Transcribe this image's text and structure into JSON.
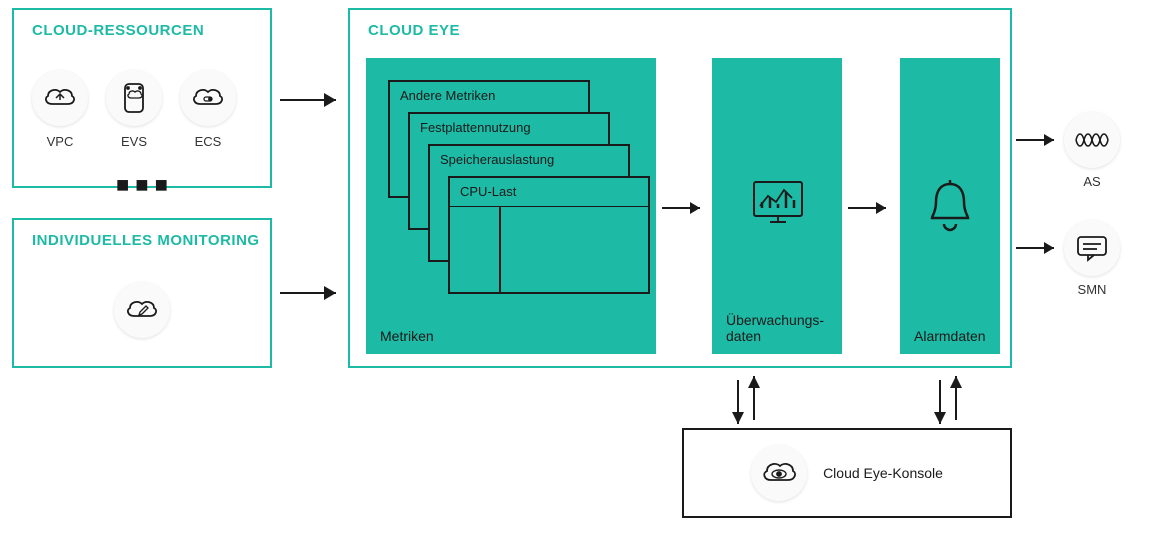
{
  "cloud_resources": {
    "title": "CLOUD-RESSOURCEN",
    "items": [
      {
        "label": "VPC"
      },
      {
        "label": "EVS"
      },
      {
        "label": "ECS"
      }
    ],
    "ellipsis": "■ ■ ■"
  },
  "individual_monitoring": {
    "title": "INDIVIDUELLES MONITORING"
  },
  "cloud_eye": {
    "title": "CLOUD EYE",
    "metrics_panel": {
      "label": "Metriken",
      "cards": [
        "Andere Metriken",
        "Festplattennutzung",
        "Speicherauslastung",
        "CPU-Last"
      ]
    },
    "monitoring_panel": {
      "label": "Überwachungs-\ndaten"
    },
    "alarm_panel": {
      "label": "Alarmdaten"
    }
  },
  "outputs": {
    "as": "AS",
    "smn": "SMN"
  },
  "console": {
    "label": "Cloud Eye-Konsole"
  }
}
